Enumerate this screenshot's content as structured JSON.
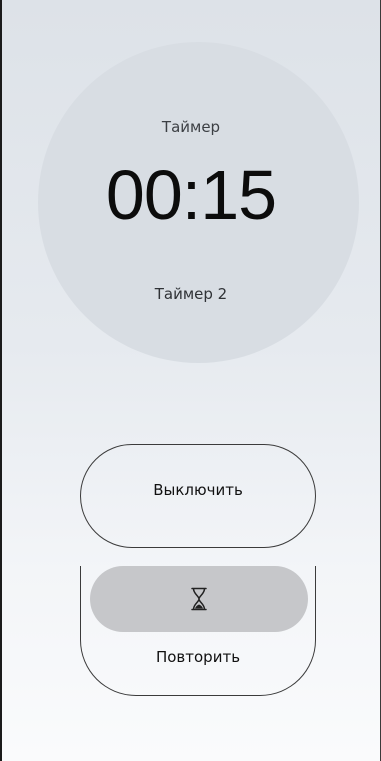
{
  "timer": {
    "name": "Таймер",
    "time": "00:15",
    "label": "Таймер 2"
  },
  "actions": {
    "off_label": "Выключить",
    "repeat_label": "Повторить",
    "hourglass_icon": "hourglass-icon"
  },
  "colors": {
    "circle": "#d8dde3",
    "pill": "#c6c7ca",
    "text": "#111111"
  }
}
